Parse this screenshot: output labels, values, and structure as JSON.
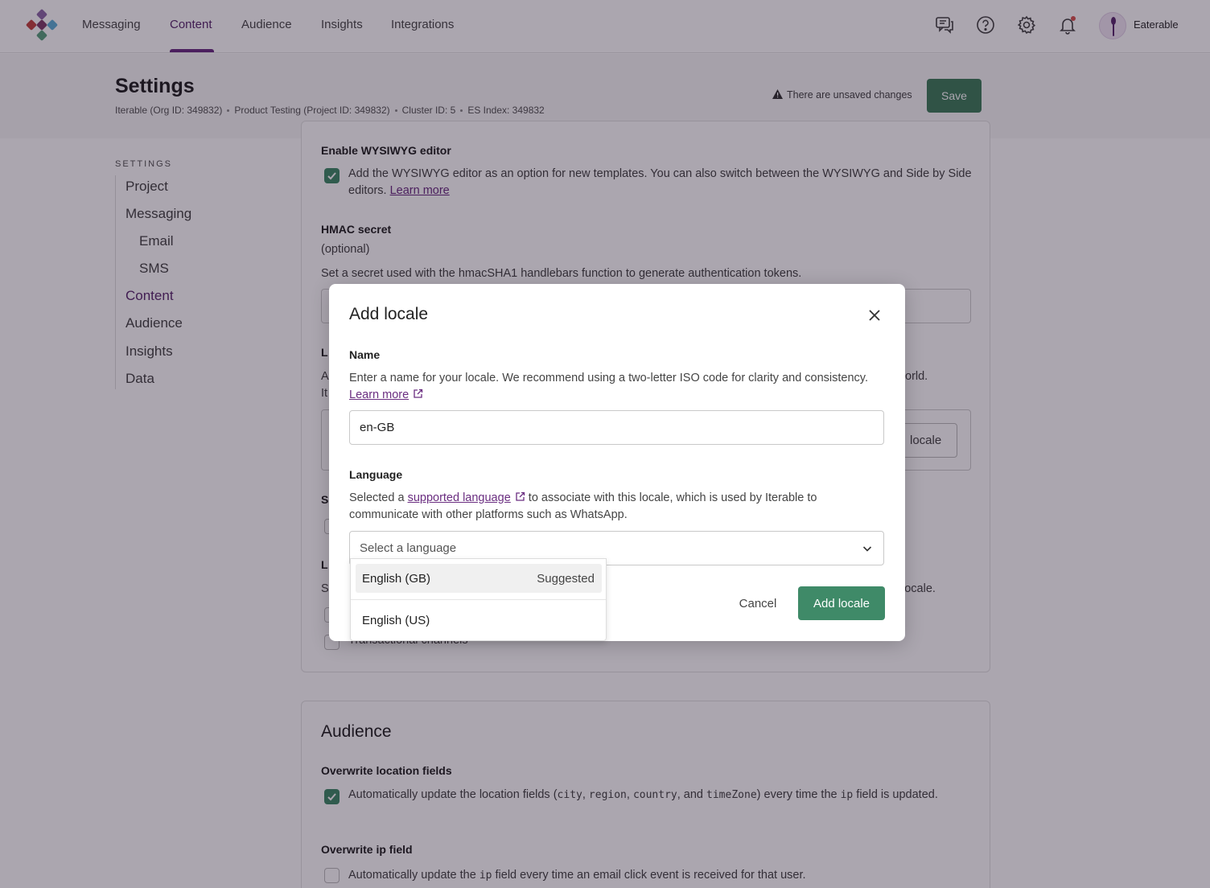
{
  "nav": {
    "items": [
      "Messaging",
      "Content",
      "Audience",
      "Insights",
      "Integrations"
    ],
    "active": "Content",
    "user_name": "Eaterable"
  },
  "header": {
    "title": "Settings",
    "org": "Iterable (Org ID: 349832)",
    "project": "Product Testing (Project ID: 349832)",
    "cluster": "Cluster ID: 5",
    "es_index": "ES Index: 349832",
    "unsaved_text": "There are unsaved changes",
    "save_label": "Save"
  },
  "sidebar": {
    "heading": "SETTINGS",
    "items": [
      "Project",
      "Messaging",
      "Email",
      "SMS",
      "Content",
      "Audience",
      "Insights",
      "Data"
    ],
    "active": "Content"
  },
  "content": {
    "wysiwyg_title": "Enable WYSIWYG editor",
    "wysiwyg_text": "Add the WYSIWYG editor as an option for new templates. You can also switch between the WYSIWYG and Side by Side editors.",
    "wysiwyg_link": "Learn more",
    "hmac_title": "HMAC secret",
    "hmac_optional": "(optional)",
    "hmac_text": "Set a secret used with the hmacSHA1 handlebars function to generate authentication tokens.",
    "frag_locales_title": "L",
    "frag_locales_text_a": "A",
    "frag_locales_text_b": "It",
    "frag_locales_right": "orld.",
    "frag_add_locale": "locale",
    "frag_s": "S",
    "frag_l": "L",
    "frag_s2": "S",
    "frag_right2": "locale.",
    "frag_transactional": "Transactional channels"
  },
  "audience": {
    "title": "Audience",
    "overwrite_loc_title": "Overwrite location fields",
    "overwrite_loc_text_1": "Automatically update the location fields (",
    "overwrite_loc_code_city": "city",
    "overwrite_loc_sep1": ",",
    "overwrite_loc_code_region": "region",
    "overwrite_loc_sep2": ",",
    "overwrite_loc_code_country": "country",
    "overwrite_loc_sep3": ", and",
    "overwrite_loc_code_tz": "timeZone",
    "overwrite_loc_text_2": ") every time the",
    "overwrite_loc_code_ip": "ip",
    "overwrite_loc_text_3": "field is updated.",
    "overwrite_ip_title": "Overwrite ip field",
    "overwrite_ip_text_1": "Automatically update the",
    "overwrite_ip_code": "ip",
    "overwrite_ip_text_2": "field every time an email click event is received for that user."
  },
  "modal": {
    "title": "Add locale",
    "name_label": "Name",
    "name_help": "Enter a name for your locale. We recommend using a two-letter ISO code for clarity and consistency.",
    "name_link": "Learn more",
    "name_value": "en-GB",
    "language_label": "Language",
    "language_help_1": "Selected a",
    "language_link": "supported language",
    "language_help_2": "to associate with this locale, which is used by Iterable to communicate with other platforms such as WhatsApp.",
    "select_placeholder": "Select a language",
    "cancel_label": "Cancel",
    "add_label": "Add locale",
    "options": [
      {
        "label": "English (GB)",
        "tag": "Suggested"
      },
      {
        "label": "English (US)",
        "tag": ""
      }
    ]
  },
  "colors": {
    "primary": "#3f8a68",
    "accent": "#6a2d80",
    "overlay": "rgba(22,8,32,0.36)"
  }
}
